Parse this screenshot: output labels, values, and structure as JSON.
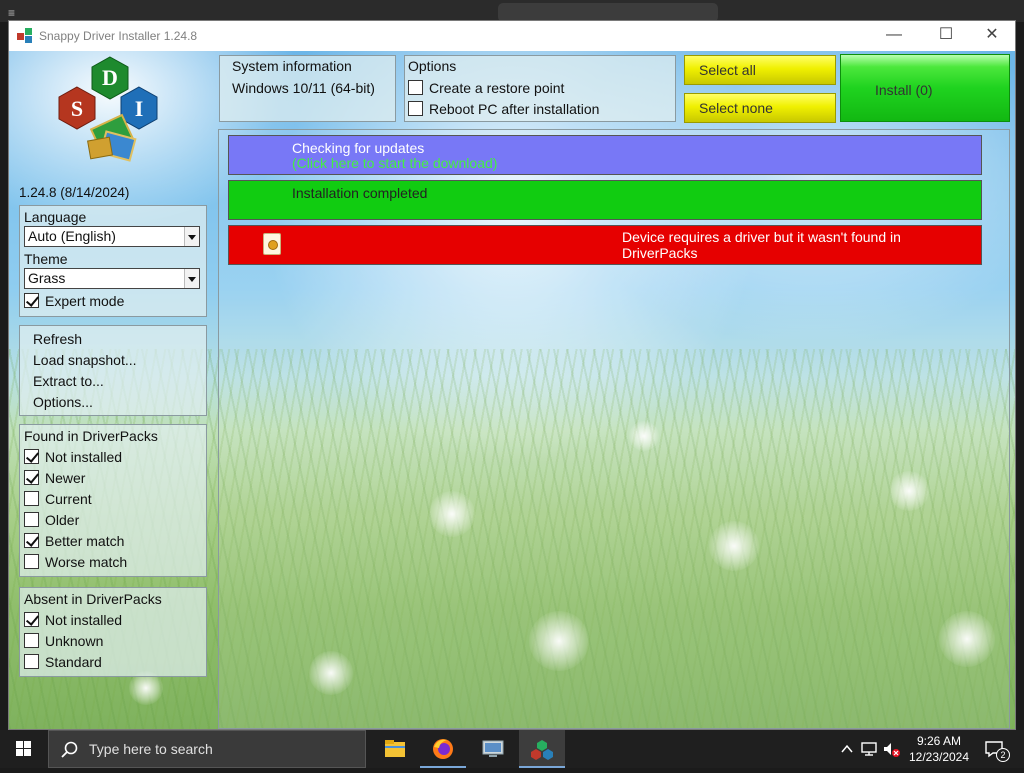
{
  "window": {
    "title": "Snappy Driver Installer 1.24.8",
    "version_label": "1.24.8 (8/14/2024)"
  },
  "system_info": {
    "heading": "System information",
    "os": "Windows 10/11 (64-bit)"
  },
  "options_panel": {
    "heading": "Options",
    "restore_point_label": "Create a restore point",
    "restore_point_checked": false,
    "reboot_label": "Reboot PC after installation",
    "reboot_checked": false
  },
  "buttons": {
    "select_all": "Select all",
    "select_none": "Select none",
    "install": "Install (0)"
  },
  "settings": {
    "language_label": "Language",
    "language_value": "Auto (English)",
    "theme_label": "Theme",
    "theme_value": "Grass",
    "expert_mode_label": "Expert mode",
    "expert_mode_checked": true
  },
  "actions_menu": {
    "items": [
      "Refresh",
      "Load snapshot...",
      "Extract to...",
      "Options..."
    ]
  },
  "found_filters": {
    "heading": "Found in DriverPacks",
    "items": [
      {
        "label": "Not installed",
        "checked": true
      },
      {
        "label": "Newer",
        "checked": true
      },
      {
        "label": "Current",
        "checked": false
      },
      {
        "label": "Older",
        "checked": false
      },
      {
        "label": "Better match",
        "checked": true
      },
      {
        "label": "Worse match",
        "checked": false
      }
    ]
  },
  "absent_filters": {
    "heading": "Absent in DriverPacks",
    "items": [
      {
        "label": "Not installed",
        "checked": true
      },
      {
        "label": "Unknown",
        "checked": false
      },
      {
        "label": "Standard",
        "checked": false
      }
    ]
  },
  "status_bars": {
    "updates_title": "Checking for updates",
    "updates_link": "(Click here to start the download)",
    "install_status": "Installation completed",
    "device_message": "Device requires a driver but it wasn't found in DriverPacks"
  },
  "taskbar": {
    "search_placeholder": "Type here to search",
    "time": "9:26 AM",
    "date": "12/23/2024",
    "notification_count": "2"
  },
  "colors": {
    "updates_bar": "#7878f6",
    "success_bar": "#11cc11",
    "missing_driver_bar": "#e60000",
    "select_button": "#f0f000",
    "install_button": "#1fd31f"
  }
}
